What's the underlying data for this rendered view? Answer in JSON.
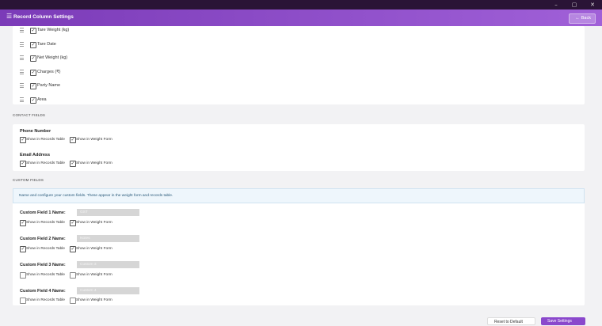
{
  "window": {
    "controls": [
      "–",
      "▢",
      "✕"
    ]
  },
  "appbar": {
    "title": "Record Column Settings",
    "back_label": "Back",
    "back_glyph": "←"
  },
  "columns": [
    {
      "label": "Tare Weight (kg)",
      "checked": true
    },
    {
      "label": "Tare Date",
      "checked": true
    },
    {
      "label": "Net Weight (kg)",
      "checked": true
    },
    {
      "label": "Charges (₹)",
      "checked": true
    },
    {
      "label": "Party Name",
      "checked": true
    },
    {
      "label": "Area",
      "checked": true
    }
  ],
  "contact": {
    "section_label": "CONTACT FIELDS",
    "fields": [
      {
        "title": "Phone Number",
        "show_records": "Show in Records Table",
        "records_checked": true,
        "show_form": "Show in Weight Form",
        "form_checked": true
      },
      {
        "title": "Email Address",
        "show_records": "Show in Records Table",
        "records_checked": true,
        "show_form": "Show in Weight Form",
        "form_checked": true
      }
    ]
  },
  "custom": {
    "section_label": "CUSTOM FIELDS",
    "info": "Name and configure your custom fields. These appear in the weight form and records table.",
    "fields": [
      {
        "label": "Custom Field 1 Name:",
        "value": "GST",
        "show_records": "Show in Records Table",
        "records_checked": true,
        "show_form": "Show in Weight Form",
        "form_checked": true
      },
      {
        "label": "Custom Field 2 Name:",
        "value": "Notes",
        "show_records": "Show in Records Table",
        "records_checked": true,
        "show_form": "Show in Weight Form",
        "form_checked": true
      },
      {
        "label": "Custom Field 3 Name:",
        "value": "Custom 3",
        "show_records": "Show in Records Table",
        "records_checked": false,
        "show_form": "Show in Weight Form",
        "form_checked": false
      },
      {
        "label": "Custom Field 4 Name:",
        "value": "Custom 4",
        "show_records": "Show in Records Table",
        "records_checked": false,
        "show_form": "Show in Weight Form",
        "form_checked": false
      }
    ]
  },
  "footer": {
    "reset_label": "Reset to Default",
    "save_label": "Save Settings"
  },
  "colors": {
    "accent": "#8a48cc",
    "titlebar": "#2a1436"
  }
}
